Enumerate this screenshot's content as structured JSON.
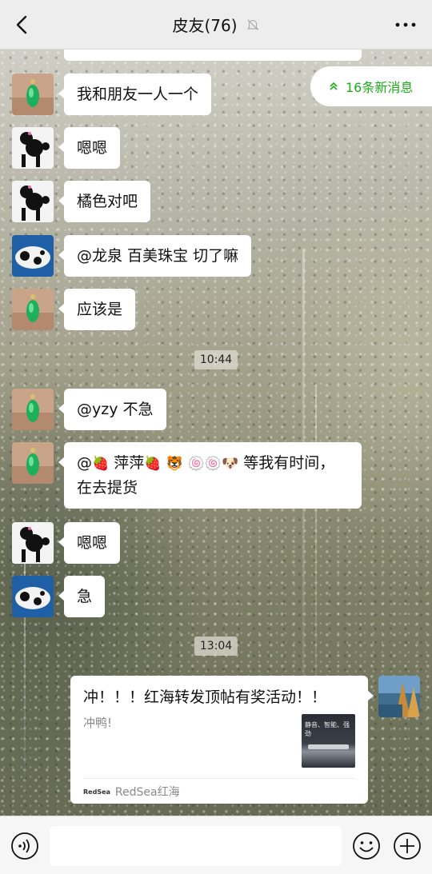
{
  "header": {
    "title": "皮友(76)"
  },
  "new_messages": {
    "label": "16条新消息"
  },
  "messages": [
    {
      "text": "我和朋友一人一个"
    },
    {
      "text": "嗯嗯"
    },
    {
      "text": "橘色对吧"
    },
    {
      "text": "@龙泉   百美珠宝 切了嘛"
    },
    {
      "text": "应该是"
    },
    {
      "time": "10:44"
    },
    {
      "text": "@yzy  不急"
    },
    {
      "text_a": "@",
      "text_b": " 萍萍",
      "text_c": " 等我有时间，在去提货"
    },
    {
      "text": "嗯嗯"
    },
    {
      "text": "急"
    },
    {
      "time": "13:04"
    }
  ],
  "share_card": {
    "title": "冲！！！红海转发顶帖有奖活动！！",
    "description": "冲鸭!",
    "thumb_text": "静音、智能、强劲",
    "source": "RedSea红海",
    "source_logo": "RedSea"
  },
  "colors": {
    "accent_green": "#1aad19",
    "header_bg": "#ededed",
    "bubble_bg": "#ffffff"
  },
  "icons": {
    "back": "chevron-left-icon",
    "mute": "bell-off-icon",
    "more": "ellipsis-icon",
    "voice": "voice-icon",
    "emoji": "emoji-icon",
    "plus": "plus-icon"
  }
}
